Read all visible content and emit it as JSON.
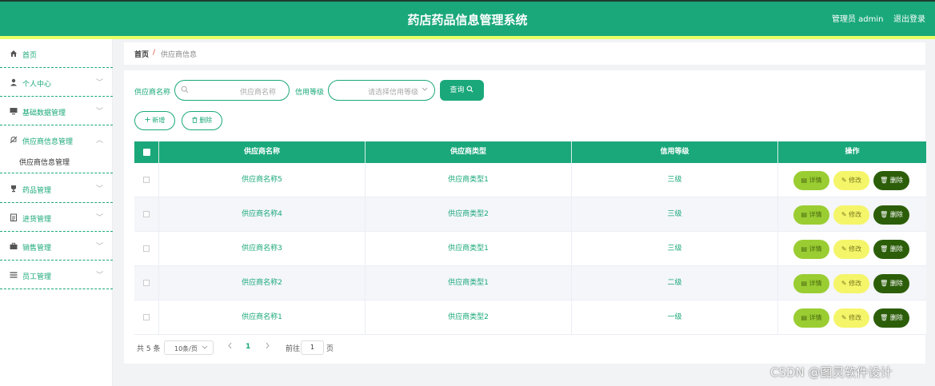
{
  "header": {
    "title": "药店药品信息管理系统",
    "user": "管理员 admin",
    "logout": "退出登录"
  },
  "sidebar": {
    "items": [
      {
        "label": "首页",
        "icon": "home-icon",
        "chevron": ""
      },
      {
        "label": "个人中心",
        "icon": "user-icon",
        "chevron": "﹀"
      },
      {
        "label": "基础数据管理",
        "icon": "monitor-icon",
        "chevron": "﹀"
      },
      {
        "label": "供应商信息管理",
        "icon": "bell-off-icon",
        "chevron": "︿"
      },
      {
        "label": "药品管理",
        "icon": "trophy-icon",
        "chevron": "﹀"
      },
      {
        "label": "进货管理",
        "icon": "list-icon",
        "chevron": "﹀"
      },
      {
        "label": "销售管理",
        "icon": "briefcase-icon",
        "chevron": "﹀"
      },
      {
        "label": "员工管理",
        "icon": "menu-icon",
        "chevron": "﹀"
      }
    ],
    "sub_item": "供应商信息管理"
  },
  "breadcrumb": {
    "home": "首页",
    "sep": "/",
    "current": "供应商信息"
  },
  "search": {
    "name_label": "供应商名称",
    "name_placeholder": "供应商名称",
    "level_label": "信用等级",
    "level_placeholder": "请选择信用等级",
    "query_button": "查询"
  },
  "actions": {
    "add": "新增",
    "delete": "删除"
  },
  "table": {
    "columns": [
      "供应商名称",
      "供应商类型",
      "信用等级",
      "操作"
    ],
    "rows": [
      {
        "name": "供应商名称5",
        "type": "供应商类型1",
        "level": "三级"
      },
      {
        "name": "供应商名称4",
        "type": "供应商类型2",
        "level": "三级"
      },
      {
        "name": "供应商名称3",
        "type": "供应商类型1",
        "level": "三级"
      },
      {
        "name": "供应商名称2",
        "type": "供应商类型1",
        "level": "二级"
      },
      {
        "name": "供应商名称1",
        "type": "供应商类型2",
        "level": "一级"
      }
    ],
    "row_actions": {
      "detail": "详情",
      "edit": "修改",
      "delete": "删除"
    }
  },
  "pagination": {
    "total": "共 5 条",
    "page_size": "10条/页",
    "current_page": "1",
    "goto_label": "前往",
    "goto_value": "1",
    "page_suffix": "页"
  },
  "watermark": "CSDN @图灵软件设计",
  "colors": {
    "primary": "#1aa87a",
    "accent_bar": "#e8ff66",
    "detail_btn": "#9acd32",
    "edit_btn": "#f5f56a",
    "delete_btn": "#2c5e0a"
  }
}
